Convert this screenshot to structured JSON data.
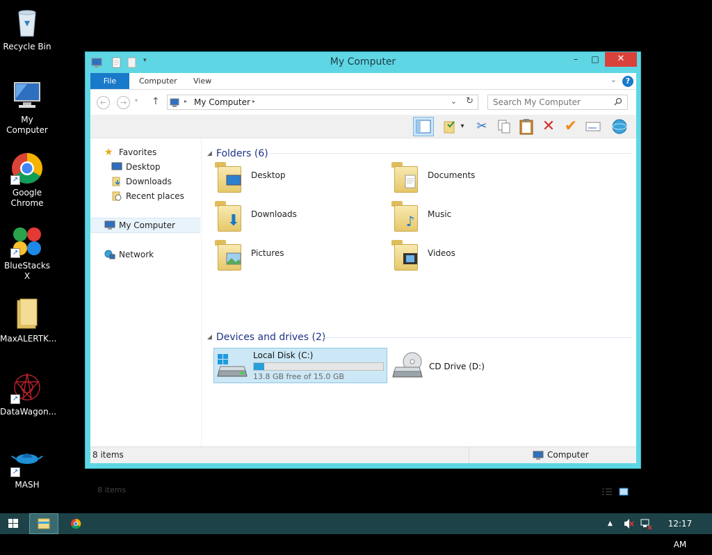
{
  "desktop": {
    "icons": [
      {
        "label": "Recycle Bin"
      },
      {
        "label": "My Computer"
      },
      {
        "label": "Google Chrome"
      },
      {
        "label": "BlueStacks X"
      },
      {
        "label": "MaxALERTK..."
      },
      {
        "label": "DataWagon..."
      },
      {
        "label": "MASH"
      }
    ]
  },
  "window": {
    "title": "My Computer",
    "minimize_label": "–",
    "maximize_label": "□",
    "close_label": "✕"
  },
  "ribbon": {
    "tabs": [
      {
        "label": "File"
      },
      {
        "label": "Computer"
      },
      {
        "label": "View"
      }
    ],
    "help_label": "?"
  },
  "address": {
    "path": "My Computer",
    "search_placeholder": "Search My Computer"
  },
  "nav": {
    "favorites": "Favorites",
    "desktop": "Desktop",
    "downloads": "Downloads",
    "recent": "Recent places",
    "mycomputer": "My Computer",
    "network": "Network"
  },
  "main": {
    "folders_header": "Folders (6)",
    "folders": [
      {
        "label": "Desktop"
      },
      {
        "label": "Documents"
      },
      {
        "label": "Downloads"
      },
      {
        "label": "Music"
      },
      {
        "label": "Pictures"
      },
      {
        "label": "Videos"
      }
    ],
    "devices_header": "Devices and drives (2)",
    "drives": [
      {
        "label": "Local Disk (C:)",
        "free_text": "13.8 GB free of 15.0 GB",
        "used_fraction": 0.08
      },
      {
        "label": "CD Drive (D:)"
      }
    ],
    "item_count": "8 items"
  },
  "status": {
    "count": "8 items",
    "location": "Computer"
  },
  "taskbar": {
    "clock": "12:17 AM"
  },
  "colors": {
    "window_frame": "#5fd6e4",
    "accent": "#1979ca",
    "close": "#d9423b",
    "taskbar": "#1d4348"
  }
}
